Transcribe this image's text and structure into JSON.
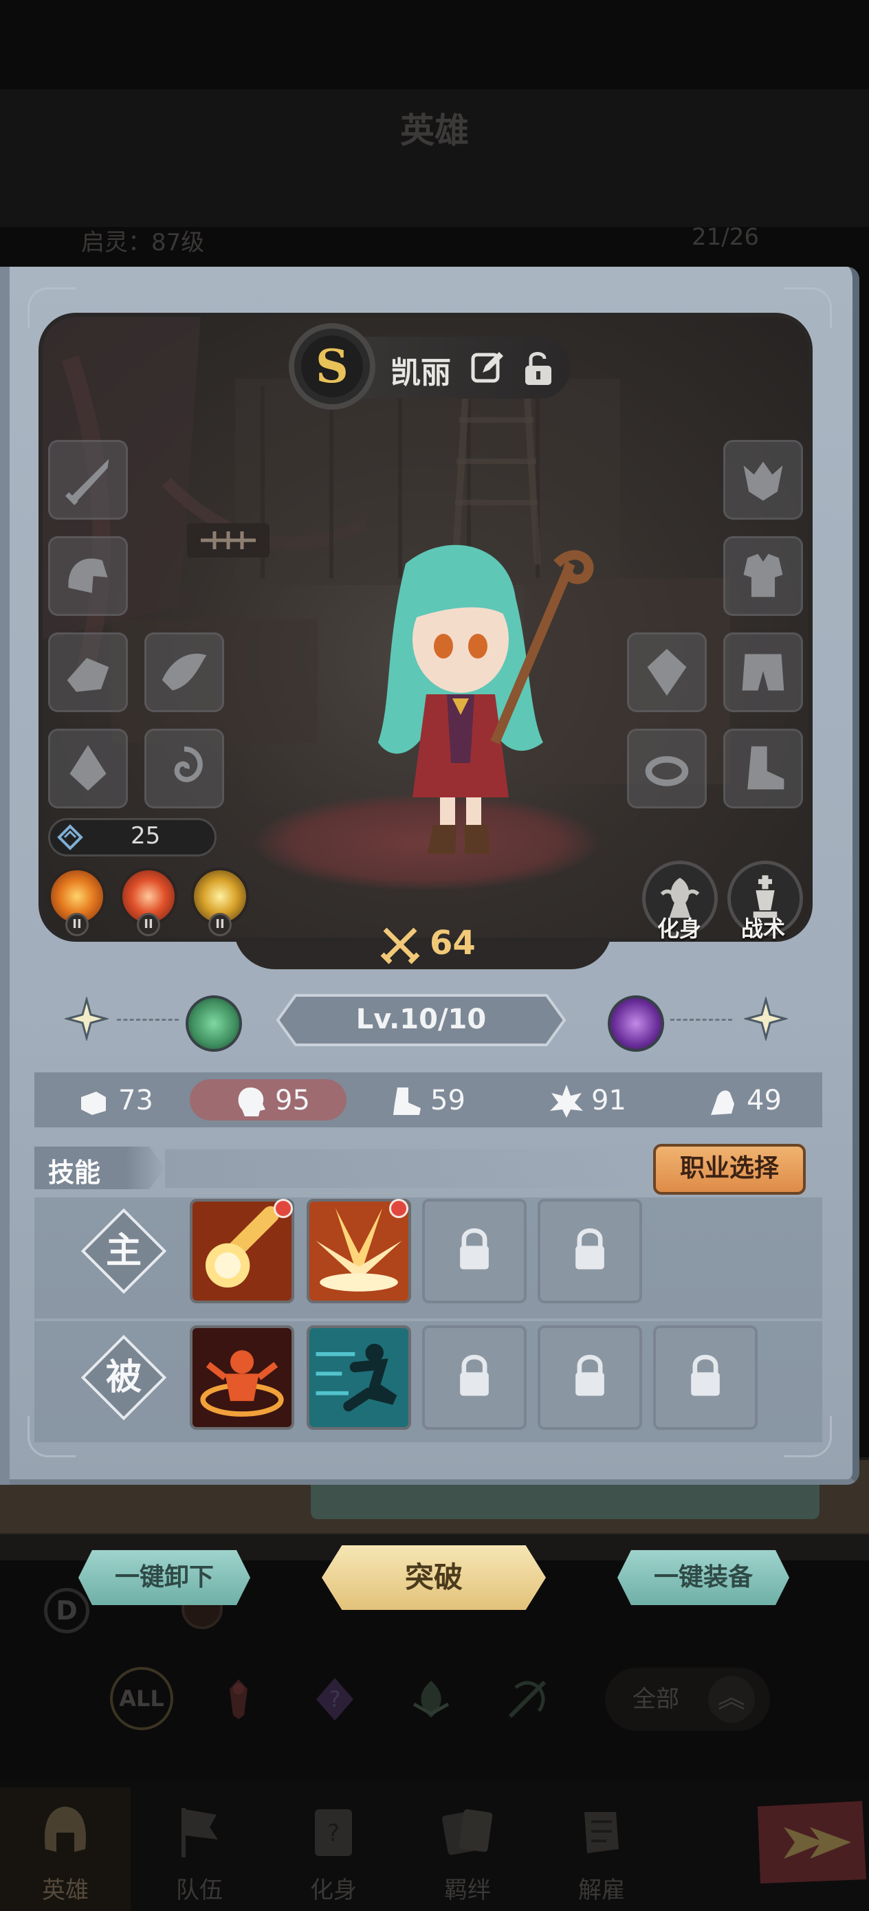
{
  "screen": {
    "title": "英雄",
    "awaken_level": "启灵：87级",
    "hero_count": "21/26"
  },
  "hero": {
    "rank": "S",
    "name": "凯丽",
    "power": "25",
    "attack": "64",
    "level": "Lv.10/10",
    "transform_label": "化身",
    "tactics_label": "战术",
    "skill_orb_badge": "II"
  },
  "stats": [
    {
      "icon": "fist-icon",
      "value": "73"
    },
    {
      "icon": "head-icon",
      "value": "95"
    },
    {
      "icon": "boot-icon",
      "value": "59"
    },
    {
      "icon": "burst-icon",
      "value": "91"
    },
    {
      "icon": "arm-icon",
      "value": "49"
    }
  ],
  "skills": {
    "title": "技能",
    "class_select": "职业选择",
    "active_label": "主",
    "passive_label": "被"
  },
  "actions": {
    "unequip_all": "一键卸下",
    "breakthrough": "突破",
    "equip_all": "一键装备"
  },
  "filters": {
    "all": "ALL",
    "all_dropdown": "全部"
  },
  "tabs": [
    {
      "label": "英雄",
      "icon": "helmet-icon",
      "active": true
    },
    {
      "label": "队伍",
      "icon": "flag-icon",
      "active": false
    },
    {
      "label": "化身",
      "icon": "card-icon",
      "active": false
    },
    {
      "label": "羁绊",
      "icon": "cards-icon",
      "active": false
    },
    {
      "label": "解雇",
      "icon": "scroll-icon",
      "active": false
    }
  ],
  "bg_left_letter": "D",
  "colors": {
    "accent_gold": "#f1c978",
    "highlight_stat": "#9e6b71",
    "class_button": "#de8c48",
    "action_green": "#6fb0a7"
  }
}
